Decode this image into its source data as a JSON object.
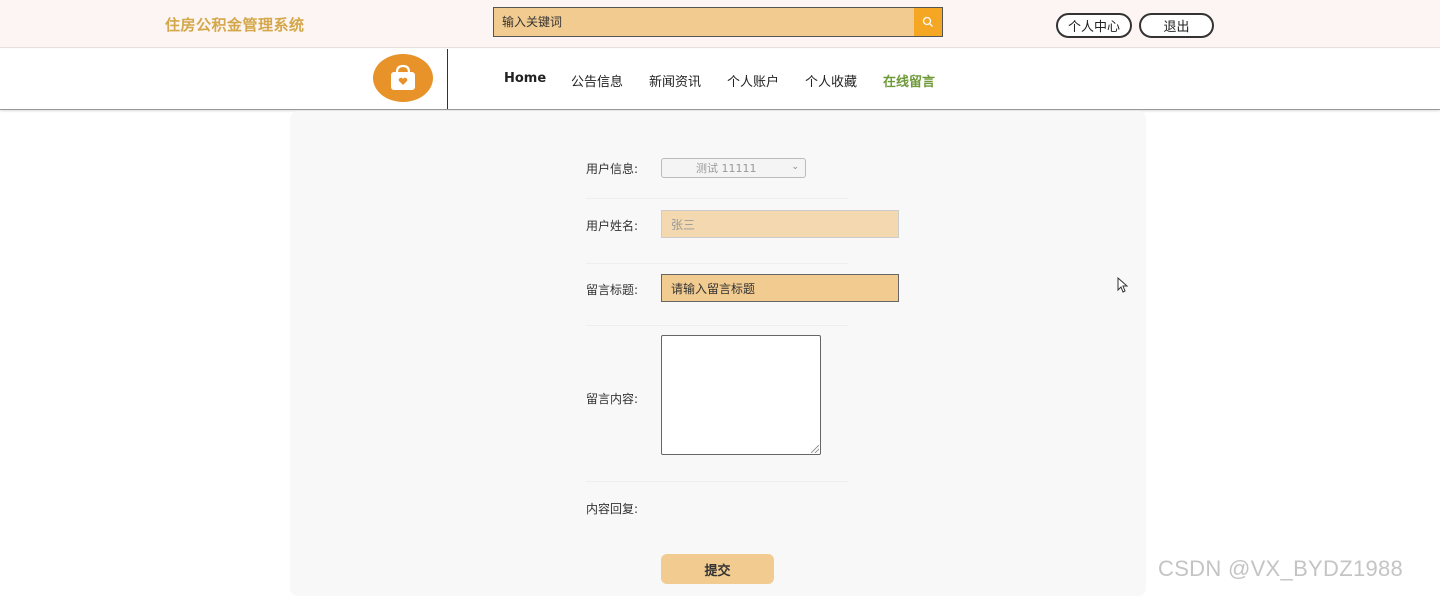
{
  "header": {
    "site_title": "住房公积金管理系统",
    "search_placeholder": "输入关键词",
    "user_center_label": "个人中心",
    "logout_label": "退出",
    "accent_color": "#f1cb90"
  },
  "nav": {
    "items": [
      {
        "label": "Home"
      },
      {
        "label": "公告信息"
      },
      {
        "label": "新闻资讯"
      },
      {
        "label": "个人账户"
      },
      {
        "label": "个人收藏"
      },
      {
        "label": "在线留言"
      }
    ],
    "active_label": "在线留言",
    "active_color": "#6f9a3a"
  },
  "form": {
    "user_info_label": "用户信息:",
    "user_info_value": "测试 11111",
    "account_name_label": "用户姓名:",
    "account_name_value": "张三",
    "title_label": "留言标题:",
    "title_placeholder": "请输入留言标题",
    "content_label": "留言内容:",
    "content_value": "",
    "reply_label": "内容回复:",
    "submit_label": "提交"
  },
  "watermark": "CSDN @VX_BYDZ1988",
  "icons": [
    "search-icon",
    "shopping-bag-logo-icon",
    "chevron-down-icon",
    "mouse-cursor-icon"
  ]
}
